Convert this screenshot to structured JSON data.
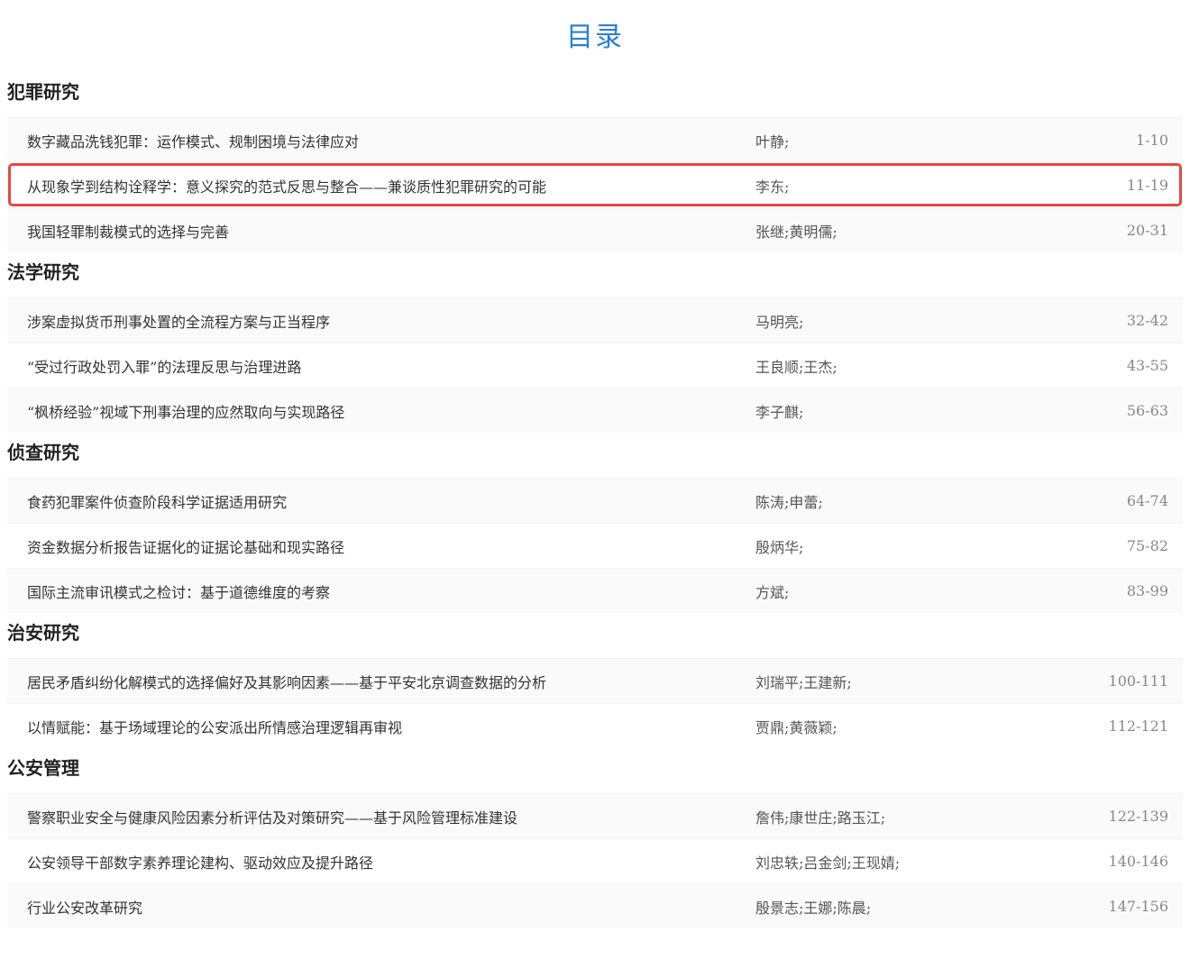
{
  "page": {
    "title": "目录"
  },
  "colors": {
    "title": "#2a7fd4",
    "highlight_border": "#e5483f"
  },
  "sections": [
    {
      "heading": "犯罪研究",
      "articles": [
        {
          "title": "数字藏品洗钱犯罪：运作模式、规制困境与法律应对",
          "authors": "叶静;",
          "pages": "1-10"
        },
        {
          "title": "从现象学到结构诠释学：意义探究的范式反思与整合——兼谈质性犯罪研究的可能",
          "authors": "李东;",
          "pages": "11-19",
          "highlighted": true
        },
        {
          "title": "我国轻罪制裁模式的选择与完善",
          "authors": "张继;黄明儒;",
          "pages": "20-31"
        }
      ]
    },
    {
      "heading": "法学研究",
      "articles": [
        {
          "title": "涉案虚拟货币刑事处置的全流程方案与正当程序",
          "authors": "马明亮;",
          "pages": "32-42"
        },
        {
          "title": "“受过行政处罚入罪”的法理反思与治理进路",
          "authors": "王良顺;王杰;",
          "pages": "43-55"
        },
        {
          "title": "“枫桥经验”视域下刑事治理的应然取向与实现路径",
          "authors": "李子麒;",
          "pages": "56-63"
        }
      ]
    },
    {
      "heading": "侦查研究",
      "articles": [
        {
          "title": "食药犯罪案件侦查阶段科学证据适用研究",
          "authors": "陈涛;申蕾;",
          "pages": "64-74"
        },
        {
          "title": "资金数据分析报告证据化的证据论基础和现实路径",
          "authors": "殷炳华;",
          "pages": "75-82"
        },
        {
          "title": "国际主流审讯模式之检讨：基于道德维度的考察",
          "authors": "方斌;",
          "pages": "83-99"
        }
      ]
    },
    {
      "heading": "治安研究",
      "articles": [
        {
          "title": "居民矛盾纠纷化解模式的选择偏好及其影响因素——基于平安北京调查数据的分析",
          "authors": "刘瑞平;王建新;",
          "pages": "100-111"
        },
        {
          "title": "以情赋能：基于场域理论的公安派出所情感治理逻辑再审视",
          "authors": "贾鼎;黄薇颖;",
          "pages": "112-121"
        }
      ]
    },
    {
      "heading": "公安管理",
      "articles": [
        {
          "title": "警察职业安全与健康风险因素分析评估及对策研究——基于风险管理标准建设",
          "authors": "詹伟;康世庄;路玉江;",
          "pages": "122-139"
        },
        {
          "title": "公安领导干部数字素养理论建构、驱动效应及提升路径",
          "authors": "刘忠轶;吕金剑;王现婧;",
          "pages": "140-146"
        },
        {
          "title": "行业公安改革研究",
          "authors": "殷景志;王娜;陈晨;",
          "pages": "147-156"
        }
      ]
    }
  ]
}
